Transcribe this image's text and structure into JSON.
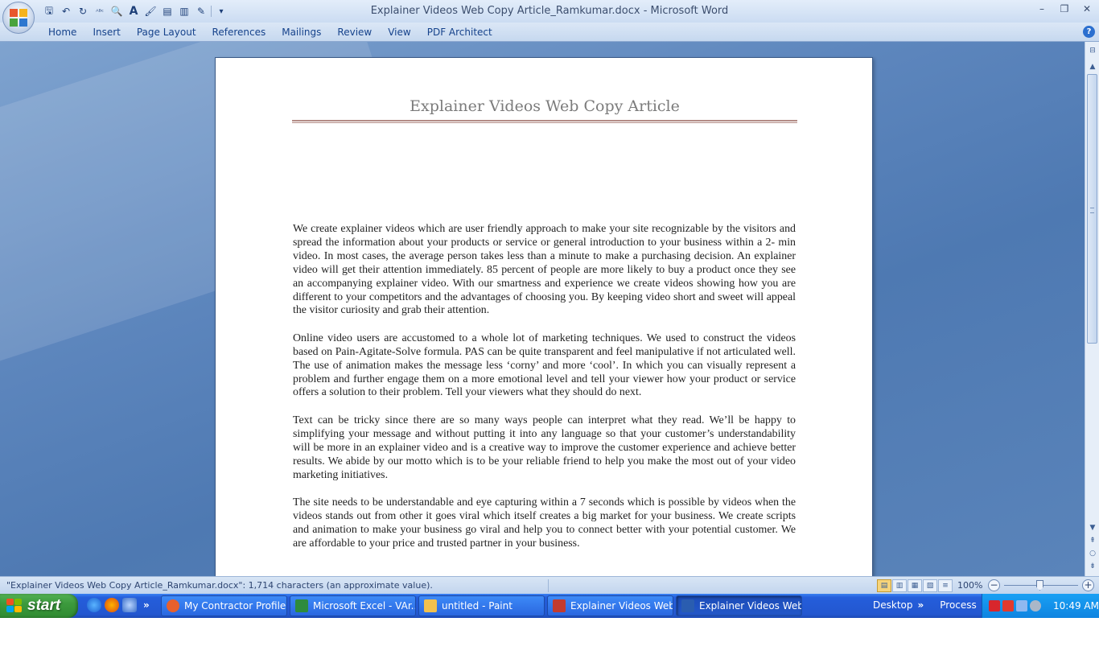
{
  "window": {
    "title": "Explainer Videos Web Copy Article_Ramkumar.docx - Microsoft Word",
    "controls": {
      "minimize": "–",
      "restore": "❐",
      "close": "✕"
    }
  },
  "quick_access": {
    "icons": [
      "save-icon",
      "undo-icon",
      "redo-icon",
      "spelling-icon",
      "print-preview-icon",
      "font-icon",
      "format-painter-icon",
      "document-icon",
      "page-icon",
      "edit-icon",
      "customize-icon"
    ],
    "glyphs": {
      "save": "🖫",
      "undo": "↶",
      "redo": "↻",
      "abc": "ᴬᴮᶜ",
      "preview": "🔍",
      "font": "A",
      "painter": "🖌",
      "doc1": "▤",
      "doc2": "▥",
      "edit": "✎",
      "more": "▾"
    }
  },
  "ribbon": {
    "tabs": [
      "Home",
      "Insert",
      "Page Layout",
      "References",
      "Mailings",
      "Review",
      "View",
      "PDF Architect"
    ],
    "help": "?"
  },
  "document": {
    "title": "Explainer Videos Web Copy Article",
    "paragraphs": [
      "We create explainer videos which are user friendly approach to make your site recognizable by the visitors and spread the information about your products or service or general introduction to your business within a 2- min video. In most cases, the average person takes less than a minute to make a purchasing decision. An explainer video will get their attention immediately. 85 percent of people are more likely to buy a product once they see an accompanying explainer video. With our smartness and experience we create videos showing how you are different to your competitors and the advantages of choosing you. By keeping video short and sweet will appeal the visitor curiosity and grab their attention.",
      "Online video users are accustomed to a whole lot of marketing techniques. We used to construct the videos based on Pain-Agitate-Solve formula. PAS can be quite transparent and feel manipulative if not articulated well. The use of animation makes the message less ‘corny’ and more ‘cool’. In which you can visually represent a problem and further engage them on a more emotional level and tell your viewer how your product or service offers a solution to their problem. Tell your viewers what they should do next.",
      "Text can be tricky since there are so many ways people can interpret what they read. We’ll be happy to simplifying your message and without putting it into any language so that your customer’s understandability will be more in an explainer video and is a creative way to improve the customer experience and achieve better results. We abide by our motto which is to be your reliable friend to help you make the most out of your video marketing initiatives.",
      "The site needs to be understandable and eye capturing within a 7 seconds which is possible by videos when the videos stands out from other it goes viral which itself creates a big market for your business. We create scripts and animation to make your business go viral and help you to connect better with your potential customer. We are affordable to your price and trusted partner in your business."
    ]
  },
  "scrollbar": {
    "up": "▲",
    "down": "▼",
    "prev_page": "⇞",
    "select_browse": "○",
    "next_page": "⇟"
  },
  "statusbar": {
    "text": "\"Explainer Videos Web Copy Article_Ramkumar.docx\": 1,714 characters (an approximate value).",
    "zoom": "100%",
    "zoom_minus": "−",
    "zoom_plus": "+",
    "view_glyphs": [
      "▤",
      "▥",
      "▦",
      "▧",
      "≡"
    ]
  },
  "taskbar": {
    "start_label": "start",
    "quicklaunch_more": "»",
    "tasks": [
      {
        "label": "My Contractor Profile...",
        "color": "#e8602c"
      },
      {
        "label": "Microsoft Excel - VAr...",
        "color": "#2e8b3d"
      },
      {
        "label": "untitled - Paint",
        "color": "#f2c14e"
      },
      {
        "label": "Explainer Videos Web...",
        "color": "#c23b2f"
      },
      {
        "label": "Explainer Videos Web...",
        "color": "#2a5db0"
      }
    ],
    "toolbars": [
      "Desktop",
      "Process"
    ],
    "toolbar_more": "»",
    "clock": "10:49 AM"
  }
}
